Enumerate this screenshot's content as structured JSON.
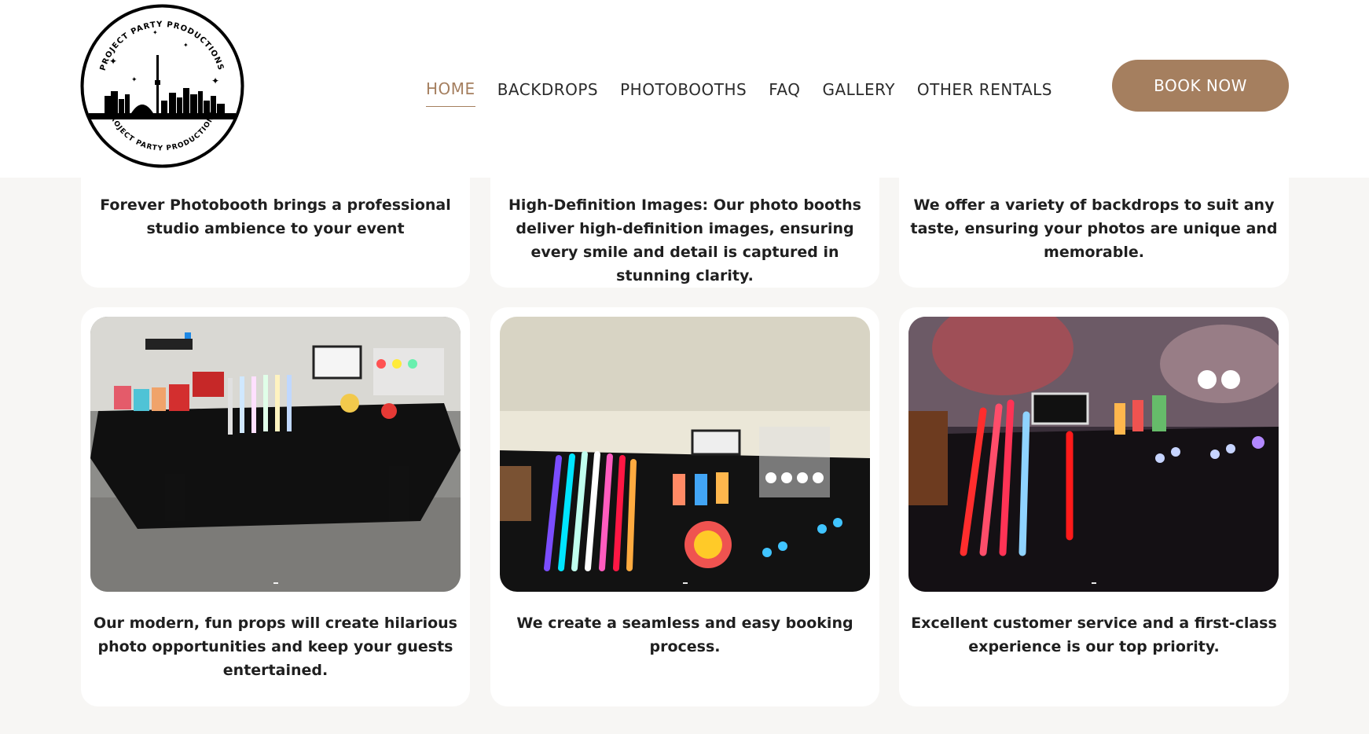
{
  "header": {
    "logo_alt": "Project Party Productions",
    "logo_text_top": "PROJECT PARTY PRODUCTIONS",
    "logo_text_bottom": "PROJECT PARTY PRODUCTIONS",
    "nav": [
      {
        "label": "HOME",
        "active": true
      },
      {
        "label": "BACKDROPS",
        "active": false
      },
      {
        "label": "PHOTOBOOTHS",
        "active": false
      },
      {
        "label": "FAQ",
        "active": false
      },
      {
        "label": "GALLERY",
        "active": false
      },
      {
        "label": "OTHER RENTALS",
        "active": false
      }
    ],
    "book_label": "BOOK NOW"
  },
  "colors": {
    "accent": "#a57f5f",
    "page_background": "#f7f6f4",
    "card_background": "#ffffff"
  },
  "top_cards": [
    {
      "text": "Forever Photobooth brings a professional studio ambience to your event"
    },
    {
      "text": "High-Definition Images: Our photo booths deliver high-definition images, ensuring every smile and detail is captured in stunning clarity."
    },
    {
      "text": "We offer a variety of backdrops to suit any taste, ensuring your photos are unique and memorable."
    }
  ],
  "bottom_cards": [
    {
      "image": "props-table-outdoor-photo",
      "text": "Our modern, fun props will create hilarious photo opportunities and keep your guests entertained."
    },
    {
      "image": "props-light-sabers-photo",
      "text": "We create a seamless and easy booking process."
    },
    {
      "image": "props-glowing-table-photo",
      "text": "Excellent customer service and a first-class experience is our top priority."
    }
  ]
}
